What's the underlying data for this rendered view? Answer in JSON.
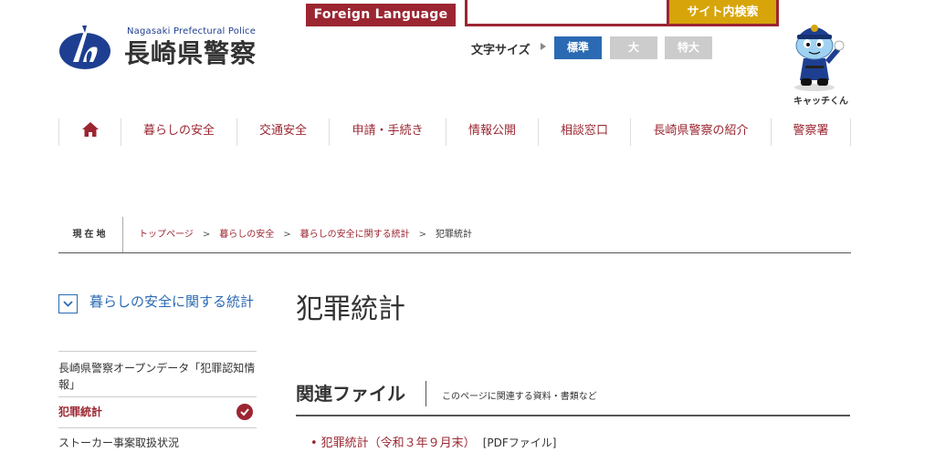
{
  "header": {
    "logo_en": "Nagasaki Prefectural Police",
    "logo_jp": "長崎県警察",
    "foreign_language": "Foreign Language",
    "search_placeholder": "",
    "search_button": "サイト内検索",
    "font_size_label": "文字サイズ",
    "font_sizes": [
      "標準",
      "大",
      "特大"
    ],
    "mascot_name": "キャッチくん"
  },
  "nav": {
    "items": [
      "暮らしの安全",
      "交通安全",
      "申請・手続き",
      "情報公開",
      "相談窓口",
      "長崎県警察の紹介",
      "警察署"
    ]
  },
  "breadcrumb": {
    "label": "現在地",
    "items": [
      "トップページ",
      "暮らしの安全",
      "暮らしの安全に関する統計"
    ],
    "current": "犯罪統計"
  },
  "sidebar": {
    "heading": "暮らしの安全に関する統計",
    "items": [
      "長崎県警察オープンデータ「犯罪認知情報」",
      "犯罪統計",
      "ストーカー事案取扱状況"
    ]
  },
  "main": {
    "title": "犯罪統計",
    "section_title": "関連ファイル",
    "section_sub": "このページに関連する資料・書類など",
    "files": [
      {
        "label": "犯罪統計（令和３年９月末）",
        "type": "[PDFファイル]"
      }
    ]
  },
  "colors": {
    "brand_red": "#9b2631",
    "brand_blue": "#2b6ab3",
    "search_gold": "#d7a50a",
    "logo_navy": "#1e3f91"
  }
}
